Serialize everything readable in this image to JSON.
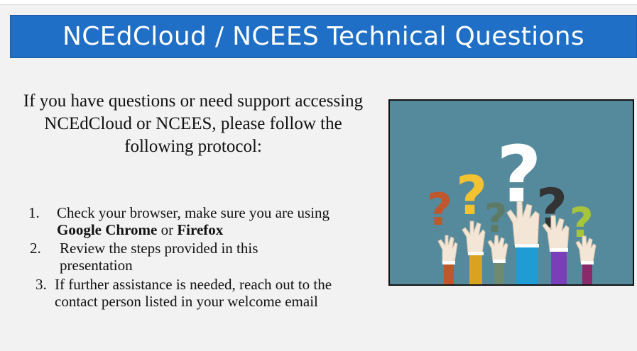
{
  "slide": {
    "title": "NCEdCloud / NCEES Technical Questions",
    "intro": "If you have questions or need support accessing NCEdCloud or NCEES, please follow the following protocol:",
    "steps": [
      {
        "number": "1.",
        "text_before": "Check your browser, make sure you are using ",
        "bold1": "Google Chrome",
        "middle": " or ",
        "bold2": "Firefox"
      },
      {
        "number": "2.",
        "text": "Review the steps provided in this presentation"
      },
      {
        "number": "3.",
        "text": "If further assistance is needed, reach out to the contact person listed in your welcome email"
      }
    ]
  },
  "image": {
    "description_icon": "raised-hands-question-marks-icon",
    "background_color": "#558a9c",
    "question_colors": [
      "#c0562b",
      "#f2c230",
      "#5d7a66",
      "#ffffff",
      "#333333",
      "#a8c43a"
    ]
  }
}
